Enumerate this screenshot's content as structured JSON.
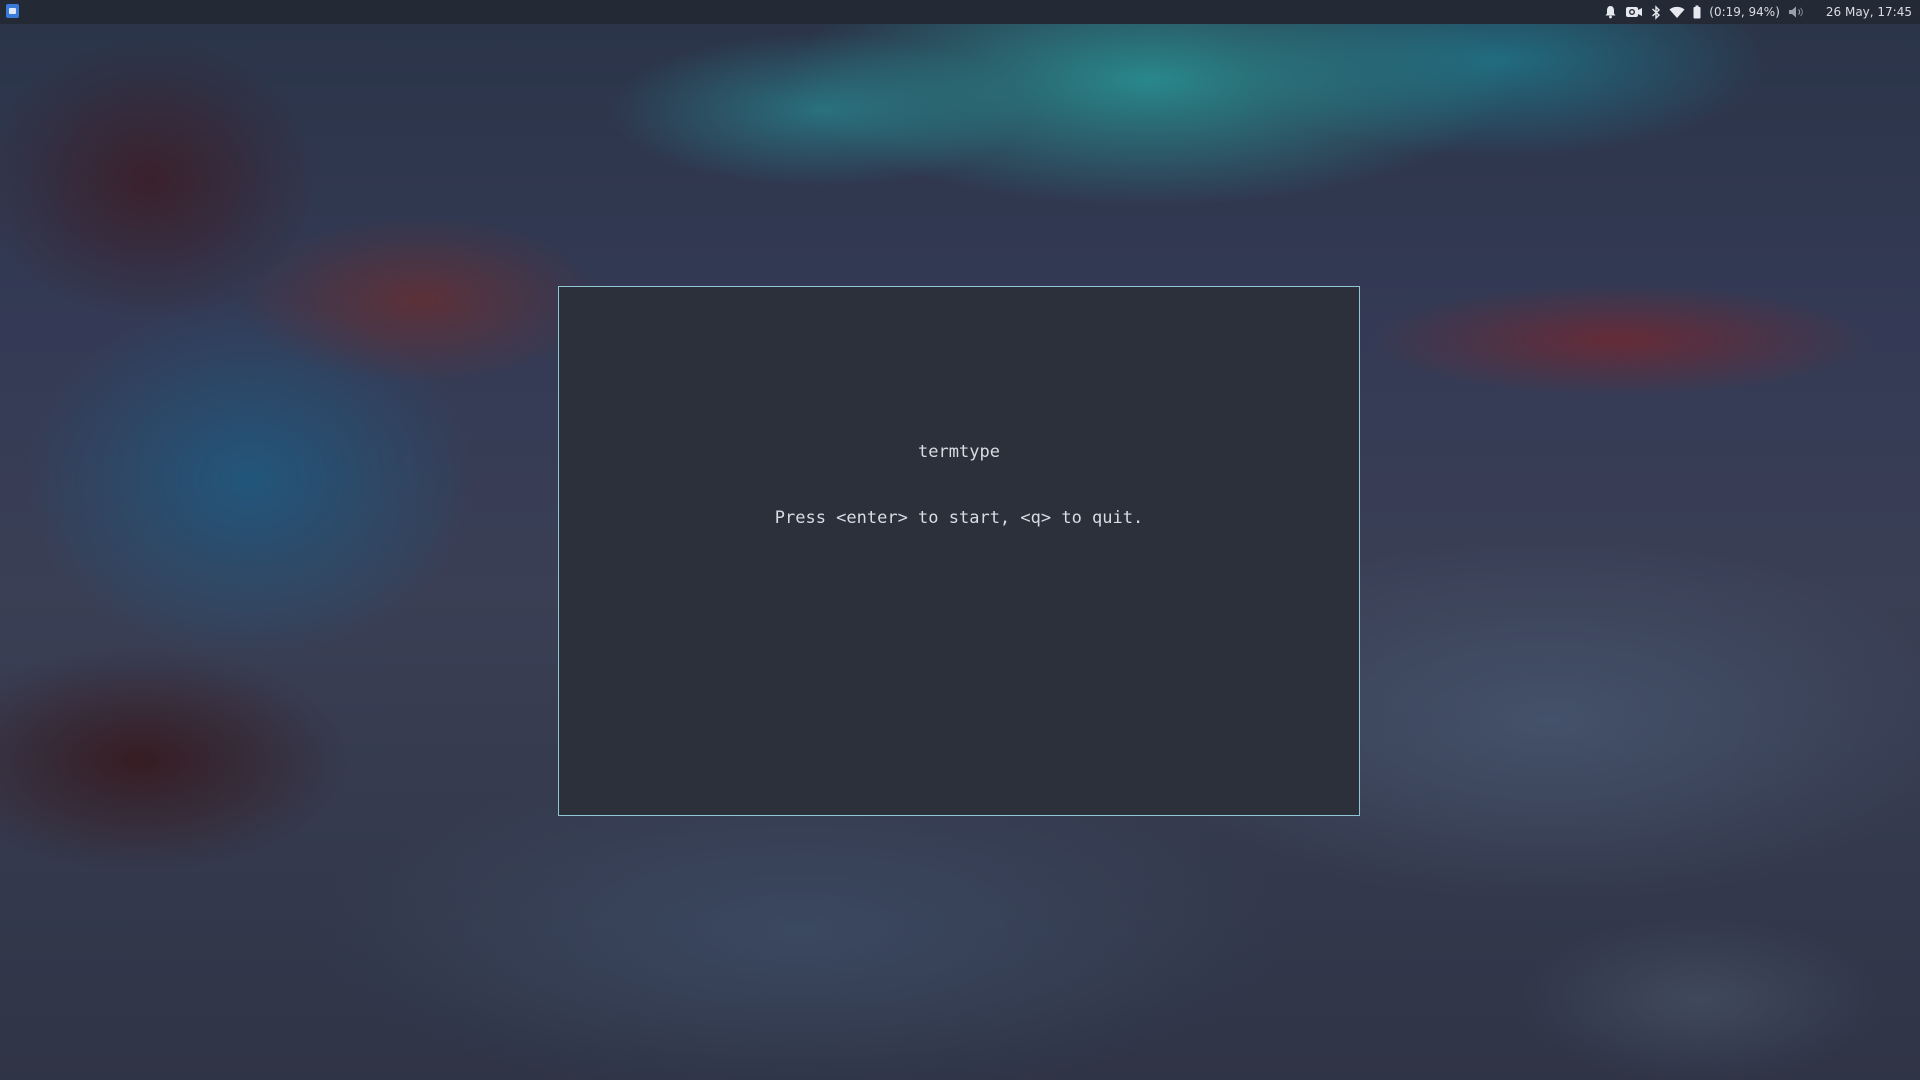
{
  "panel": {
    "app_menu_icon": "app-menu-icon",
    "tray_icons": [
      "bell-icon",
      "camera-icon",
      "bluetooth-icon",
      "wifi-icon",
      "battery-icon",
      "volume-icon"
    ],
    "battery_status": "(0:19, 94%)",
    "clock": "26 May, 17:45"
  },
  "terminal": {
    "title": "termtype",
    "instructions": "Press <enter> to start, <q> to quit."
  },
  "colors": {
    "panel_bg": "#242a35",
    "terminal_bg": "#2b303b",
    "terminal_border": "#8fc7d4",
    "terminal_text": "#d9dde3"
  }
}
